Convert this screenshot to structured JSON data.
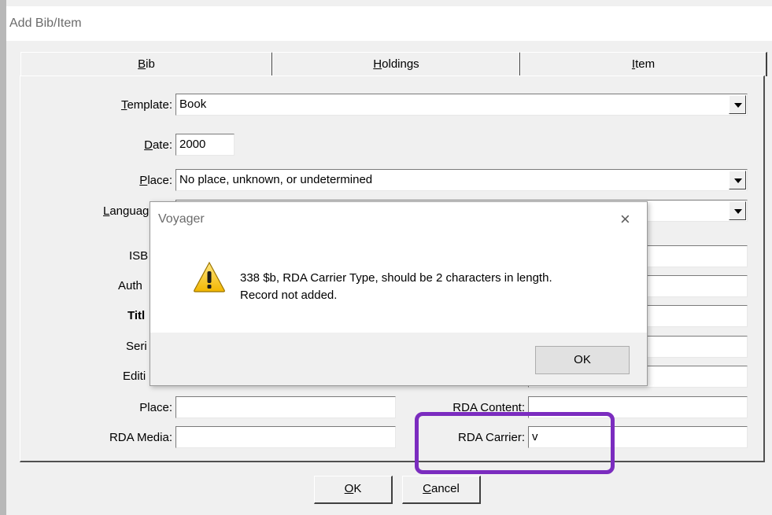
{
  "window": {
    "title": "Add Bib/Item"
  },
  "tabs": [
    {
      "label": "Bib",
      "mnemonic": "B",
      "rest": "ib"
    },
    {
      "label": "Holdings",
      "mnemonic": "H",
      "rest": "oldings"
    },
    {
      "label": "Item",
      "mnemonic": "I",
      "rest": "tem"
    }
  ],
  "form": {
    "template_label_m": "T",
    "template_label_rest": "emplate:",
    "template_value": "Book",
    "date_label_m": "D",
    "date_label_rest": "ate:",
    "date_value": "2000",
    "place_label_m": "P",
    "place_label_rest": "lace:",
    "place_value": "No place, unknown, or undetermined",
    "language_label_m": "L",
    "language_label_rest": "anguag",
    "isbn_label": "ISB",
    "author_label": "Auth",
    "title_label": "Titl",
    "series_label": "Seri",
    "edition_label": "Editi",
    "place2_label": "Place:",
    "rda_content_label": "RDA Content:",
    "rda_media_label": "RDA Media:",
    "rda_carrier_label": "RDA Carrier:",
    "rda_carrier_value": "v"
  },
  "buttons": {
    "ok_m": "O",
    "ok_rest": "K",
    "cancel_m": "C",
    "cancel_rest": "ancel"
  },
  "dialog": {
    "title": "Voyager",
    "close": "×",
    "message_line1": "338 $b, RDA Carrier Type, should be 2 characters in length.",
    "message_line2": "Record not added.",
    "ok": "OK",
    "icon": "warning-icon"
  },
  "colors": {
    "highlight": "#7b2cbf",
    "face": "#f0f0f0"
  }
}
